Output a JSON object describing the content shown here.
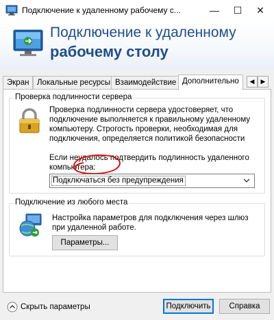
{
  "window": {
    "title": "Подключение к удаленному рабочему с...",
    "minimize_glyph": "—",
    "maximize_glyph": "☐",
    "close_glyph": "✕"
  },
  "banner": {
    "line1": "Подключение к удаленному",
    "line2": "рабочему столу"
  },
  "tabs": [
    {
      "label": "Экран",
      "active": false
    },
    {
      "label": "Локальные ресурсы",
      "active": false
    },
    {
      "label": "Взаимодействие",
      "active": false
    },
    {
      "label": "Дополнительно",
      "active": true
    }
  ],
  "tab_scroll": {
    "left": "◀",
    "right": "▶"
  },
  "server_auth": {
    "group_label": "Проверка подлинности сервера",
    "description": "Проверка подлинности сервера удостоверяет, что подключение выполняется к правильному удаленному компьютеру. Строгость проверки, необходимая для подключения, определяется политикой безопасности",
    "fail_prompt": "Если неудалось подтвердить подлинность удаленного компьютера:",
    "select_value": "Подключаться без предупреждения"
  },
  "anywhere": {
    "group_label": "Подключение из любого места",
    "description": "Настройка параметров для подключения через шлюз при удаленной работе.",
    "params_button": "Параметры..."
  },
  "footer": {
    "hide_options": "Скрыть параметры",
    "connect_button": "Подключить",
    "help_button": "Справка"
  },
  "colors": {
    "banner_text": "#1f4e8a",
    "annotation": "#e00000",
    "focus_border": "#0078d7"
  },
  "icons": {
    "app": "rdp-app-icon",
    "banner": "rdp-monitor-icon",
    "lock": "padlock-icon",
    "gateway": "globe-network-icon",
    "toggle": "chevron-up-circle-icon"
  }
}
